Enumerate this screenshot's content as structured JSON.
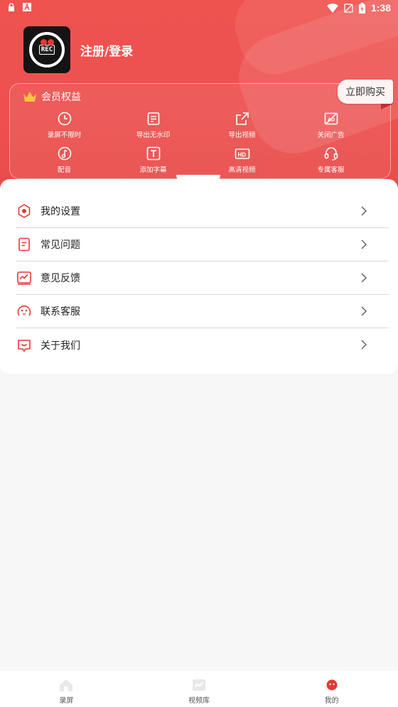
{
  "status_bar": {
    "time": "1:38",
    "icons_left": [
      "lock-icon",
      "font-a-icon"
    ],
    "icons_right": [
      "wifi-icon",
      "no-sim-icon",
      "battery-icon"
    ]
  },
  "colors": {
    "brand_red": "#ef5350",
    "tab_active": "#e53935",
    "text": "#222222"
  },
  "profile": {
    "login_label": "注册/登录",
    "avatar_icon": "rec-camera-icon",
    "avatar_text": "REC"
  },
  "vip": {
    "title": "会员权益",
    "buy_label": "立即购买",
    "benefits": [
      {
        "label": "录屏不限时",
        "icon": "clock-icon"
      },
      {
        "label": "导出无水印",
        "icon": "document-icon"
      },
      {
        "label": "导出视频",
        "icon": "export-icon"
      },
      {
        "label": "关闭广告",
        "icon": "ad-off-icon"
      },
      {
        "label": "配音",
        "icon": "music-icon"
      },
      {
        "label": "添加字幕",
        "icon": "text-icon"
      },
      {
        "label": "高清视频",
        "icon": "hd-icon"
      },
      {
        "label": "专属客服",
        "icon": "headset-icon"
      }
    ]
  },
  "menu": [
    {
      "label": "我的设置",
      "icon": "settings-icon"
    },
    {
      "label": "常见问题",
      "icon": "faq-icon"
    },
    {
      "label": "意见反馈",
      "icon": "feedback-icon"
    },
    {
      "label": "联系客服",
      "icon": "support-icon"
    },
    {
      "label": "关于我们",
      "icon": "about-icon"
    }
  ],
  "tabs": [
    {
      "label": "录屏",
      "icon": "home-icon",
      "active": false
    },
    {
      "label": "视频库",
      "icon": "chart-icon",
      "active": false
    },
    {
      "label": "我的",
      "icon": "profile-icon",
      "active": true
    }
  ]
}
